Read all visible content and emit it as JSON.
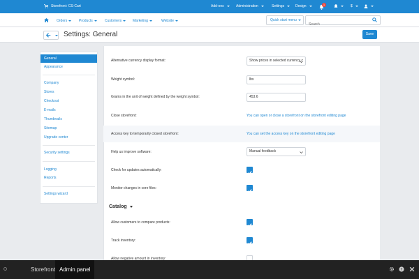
{
  "topbar": {
    "brand": "Storefront: CS-Cart",
    "menus": [
      {
        "label": "Add-ons"
      },
      {
        "label": "Administration"
      },
      {
        "label": "Settings"
      },
      {
        "label": "Design"
      }
    ],
    "notification_count": "1",
    "currency": "$",
    "bg_color": "#1f88d2"
  },
  "nav": {
    "items": [
      {
        "label": "Orders"
      },
      {
        "label": "Products"
      },
      {
        "label": "Customers"
      },
      {
        "label": "Marketing"
      },
      {
        "label": "Website"
      }
    ],
    "quick_start": "Quick start menu",
    "search_placeholder": "Search"
  },
  "page": {
    "title": "Settings: General",
    "save_label": "Save"
  },
  "sidebar": {
    "items": [
      {
        "label": "General",
        "active": true
      },
      {
        "label": "Appearance"
      },
      {
        "label": "Company"
      },
      {
        "label": "Stores"
      },
      {
        "label": "Checkout"
      },
      {
        "label": "E-mails"
      },
      {
        "label": "Thumbnails"
      },
      {
        "label": "Sitemap"
      },
      {
        "label": "Upgrade center"
      },
      {
        "label": "Security settings"
      },
      {
        "label": "Logging"
      },
      {
        "label": "Reports"
      },
      {
        "label": "Settings wizard"
      }
    ]
  },
  "settings": {
    "alt_currency": {
      "label": "Alternative currency display format:",
      "value": "Show prices in selected currency c"
    },
    "weight_symbol": {
      "label": "Weight symbol:",
      "value": "lbs"
    },
    "grams": {
      "label": "Grams in the unit of weight defined by the weight symbol:",
      "value": "453.6"
    },
    "close_storefront": {
      "label": "Close storefront:",
      "link": "You can open or close a storefront on the storefront editing page"
    },
    "access_key": {
      "label": "Access key to temporarily closed storefront:",
      "link": "You can set the access key on the storefront editing page"
    },
    "help_improve": {
      "label": "Help us improve software:",
      "value": "Manual feedback"
    },
    "check_updates": {
      "label": "Check for updates automatically:",
      "checked": true
    },
    "monitor_changes": {
      "label": "Monitor changes in core files:",
      "checked": true
    }
  },
  "catalog": {
    "title": "Catalog",
    "compare": {
      "label": "Allow customers to compare products:",
      "checked": true
    },
    "track_inventory": {
      "label": "Track inventory:",
      "checked": true
    },
    "negative_inventory": {
      "label": "Allow negative amount in inventory:",
      "checked": false
    }
  },
  "bottombar": {
    "storefront": "Storefront",
    "admin": "Admin panel"
  }
}
